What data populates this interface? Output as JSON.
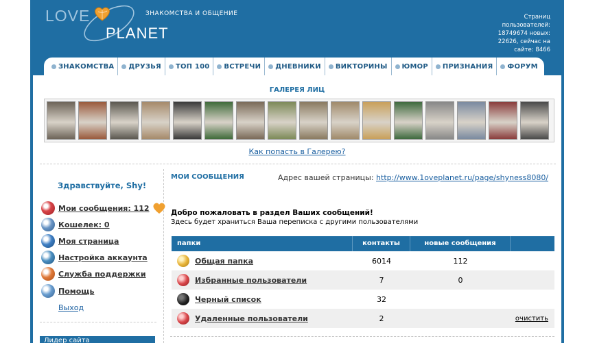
{
  "header": {
    "logo_love": "LOVE",
    "logo_planet": "PLANET",
    "tagline": "ЗНАКОМСТВА И ОБЩЕНИЕ",
    "stats_text": "Страниц пользователей: 18749674 новых: 22626, сейчас на сайте: 8466"
  },
  "nav": [
    {
      "label": "ЗНАКОМСТВА"
    },
    {
      "label": "ДРУЗЬЯ"
    },
    {
      "label": "ТОП 100"
    },
    {
      "label": "ВСТРЕЧИ"
    },
    {
      "label": "ДНЕВНИКИ"
    },
    {
      "label": "ВИКТОРИНЫ"
    },
    {
      "label": "ЮМОР"
    },
    {
      "label": "ПРИЗНАНИЯ"
    },
    {
      "label": "ФОРУМ"
    }
  ],
  "gallery": {
    "title": "ГАЛЕРЕЯ ЛИЦ",
    "link": "Как попасть в Галерею?",
    "photo_colors": [
      "#6d6458",
      "#9a5a3c",
      "#5b5850",
      "#a68a6a",
      "#3a3a3a",
      "#3f6b3a",
      "#7a6a58",
      "#7d8a58",
      "#8a7a60",
      "#a08a6a",
      "#c9a05a",
      "#3e6a3e",
      "#888888",
      "#7a8aa0",
      "#8a3c3c",
      "#4a4a4a"
    ]
  },
  "sidebar": {
    "greeting": "Здравствуйте, Shy!",
    "items": [
      {
        "label": "Мои сообщения: 112",
        "icon": "messages-icon",
        "color": "#d9464a"
      },
      {
        "label": "Кошелек: 0",
        "icon": "wallet-icon",
        "color": "#4a7db5"
      },
      {
        "label": "Моя страница",
        "icon": "my-page-icon",
        "color": "#3f7fc4"
      },
      {
        "label": "Настройка аккаунта",
        "icon": "settings-icon",
        "color": "#4a8ec0"
      },
      {
        "label": "Служба поддержки",
        "icon": "support-icon",
        "color": "#e07a3a"
      },
      {
        "label": "Помощь",
        "icon": "help-icon",
        "color": "#6a9ed0"
      }
    ],
    "logout": "Выход",
    "leaders": "Лидер сайта"
  },
  "messages": {
    "title": "МОИ СООБЩЕНИЯ",
    "address_label": "Адрес вашей страницы:",
    "address_url": "http://www.1oveplanet.ru/page/shyness8080/",
    "welcome": "Добро пожаловать в раздел Ваших сообщений!",
    "welcome_sub": "Здесь будет храниться Ваша переписка с другими пользователями",
    "columns": [
      "папки",
      "контакты",
      "новые сообщения",
      ""
    ],
    "rows": [
      {
        "name": "Общая папка",
        "contacts": "6014",
        "new": "112",
        "action": "",
        "icon": "folder-icon",
        "color": "#e8b43a"
      },
      {
        "name": "Избранные пользователи",
        "contacts": "7",
        "new": "0",
        "action": "",
        "icon": "favorites-icon",
        "color": "#d9464a"
      },
      {
        "name": "Черный список",
        "contacts": "32",
        "new": "",
        "action": "",
        "icon": "blacklist-icon",
        "color": "#222222"
      },
      {
        "name": "Удаленные пользователи",
        "contacts": "2",
        "new": "",
        "action": "очистить",
        "icon": "deleted-icon",
        "color": "#d9464a"
      }
    ]
  },
  "colors": {
    "brand_blue": "#1f6ea3",
    "link": "#1a5fa0"
  }
}
